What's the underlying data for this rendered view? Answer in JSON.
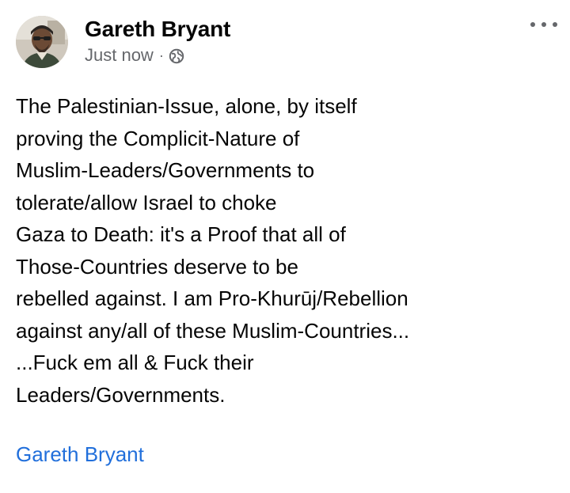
{
  "post": {
    "author": "Gareth Bryant",
    "timestamp": "Just now",
    "separator": "·",
    "audience_icon": "globe-icon",
    "more_icon": "more-options-icon",
    "message_lines": [
      "The Palestinian-Issue, alone, by itself",
      "proving the Complicit-Nature of",
      "Muslim-Leaders/Governments to",
      "tolerate/allow Israel to choke",
      "Gaza to Death: it's a Proof that all of",
      "Those-Countries deserve to be",
      "rebelled against. I am Pro-Khurūj/Rebellion",
      "against any/all of these Muslim-Countries...",
      "...Fuck em all & Fuck their",
      "Leaders/Governments."
    ],
    "tag": "Gareth Bryant"
  },
  "colors": {
    "text_primary": "#050505",
    "text_secondary": "#65676b",
    "link": "#216fdb",
    "background": "#ffffff"
  }
}
